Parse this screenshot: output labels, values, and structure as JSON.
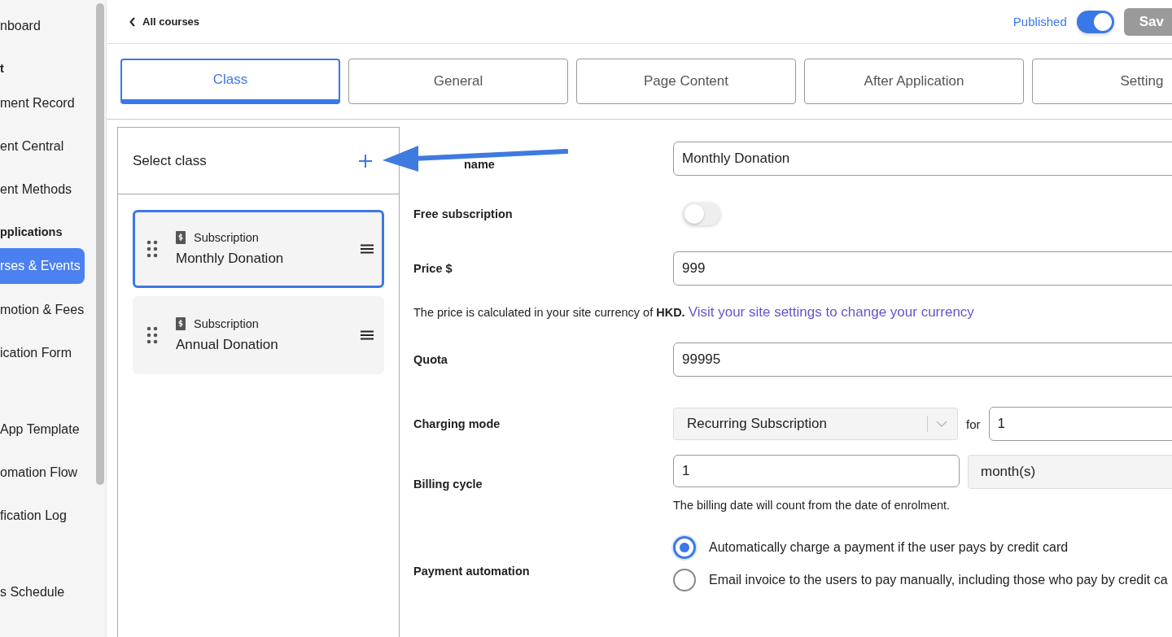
{
  "sidebar": {
    "items": [
      {
        "label": "nboard",
        "kind": "item",
        "selected": false
      },
      {
        "label": "t",
        "kind": "heading"
      },
      {
        "label": "ment Record",
        "kind": "item",
        "selected": false
      },
      {
        "label": "ent Central",
        "kind": "item",
        "selected": false
      },
      {
        "label": "ent Methods",
        "kind": "item",
        "selected": false
      },
      {
        "label": "pplications",
        "kind": "heading"
      },
      {
        "label": "rses & Events",
        "kind": "item",
        "selected": true
      },
      {
        "label": "motion & Fees",
        "kind": "item",
        "selected": false
      },
      {
        "label": "ication Form",
        "kind": "item",
        "selected": false
      },
      {
        "kind": "gap"
      },
      {
        "label": "App Template",
        "kind": "item",
        "selected": false
      },
      {
        "label": "omation Flow",
        "kind": "item",
        "selected": false
      },
      {
        "label": "fication Log",
        "kind": "item",
        "selected": false
      },
      {
        "kind": "gap"
      },
      {
        "label": "s Schedule",
        "kind": "item",
        "selected": false
      }
    ]
  },
  "header": {
    "back": "All courses",
    "published_label": "Published",
    "published": true,
    "save": "Sav"
  },
  "tabs": [
    {
      "label": "Class",
      "selected": true
    },
    {
      "label": "General",
      "selected": false
    },
    {
      "label": "Page Content",
      "selected": false
    },
    {
      "label": "After Application",
      "selected": false
    },
    {
      "label": "Setting",
      "selected": false
    }
  ],
  "class_panel": {
    "title": "Select class",
    "classes": [
      {
        "type": "Subscription",
        "name": "Monthly Donation",
        "selected": true
      },
      {
        "type": "Subscription",
        "name": "Annual Donation",
        "selected": false
      }
    ]
  },
  "form": {
    "product_name_label": "name",
    "product_name": "Monthly Donation",
    "free_label": "Free subscription",
    "free": false,
    "price_label": "Price $",
    "price": "999",
    "currency_note": "The price is calculated in your site currency of **HKD.**",
    "currency_link": "Visit your site settings to change your currency",
    "quota_label": "Quota",
    "quota": "99995",
    "charging_label": "Charging mode",
    "charging_mode": "Recurring Subscription",
    "for_label": "for",
    "for_value": "1",
    "billing_label": "Billing cycle",
    "billing_value": "1",
    "billing_unit": "month(s)",
    "billing_note": "The billing date will count from the date of enrolment.",
    "automation_label": "Payment automation",
    "automation_options": [
      {
        "label": "Automatically charge a payment if the user pays by credit card",
        "selected": true
      },
      {
        "label": "Email invoice to the users to pay manually, including those who pay by credit ca",
        "selected": false
      }
    ]
  }
}
